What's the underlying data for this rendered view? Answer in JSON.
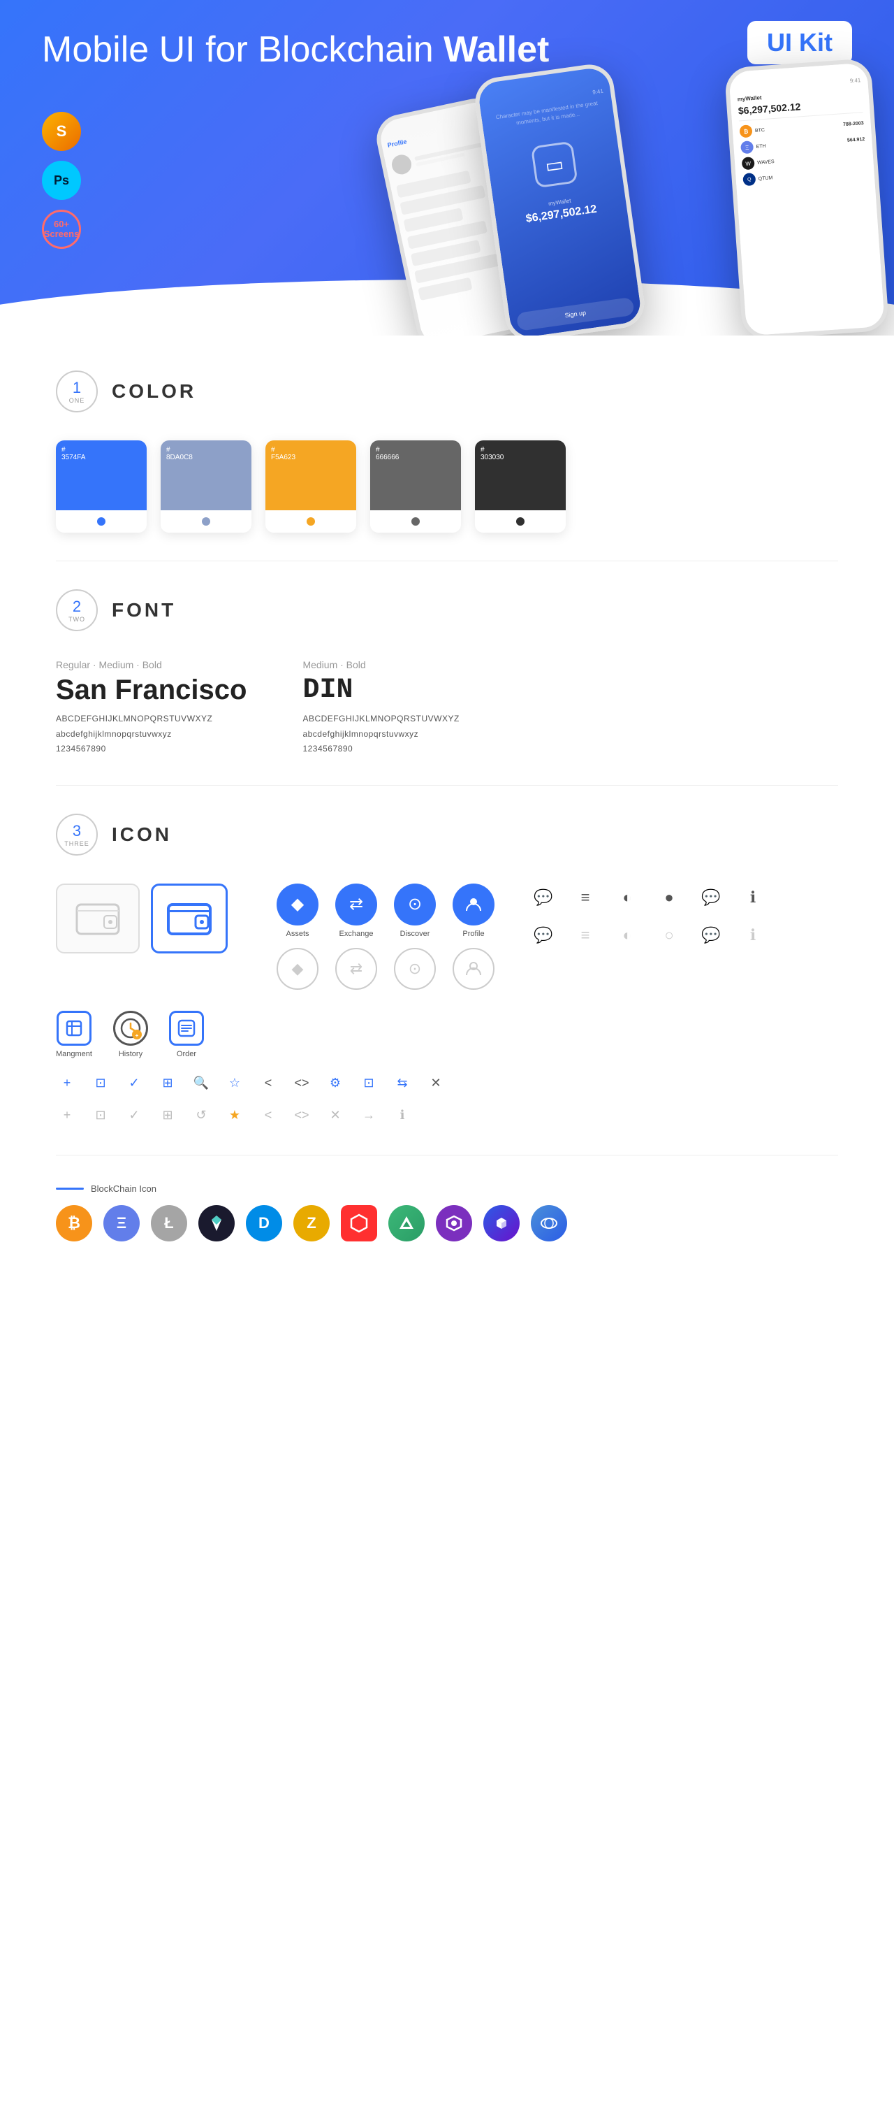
{
  "hero": {
    "title_normal": "Mobile UI for Blockchain ",
    "title_bold": "Wallet",
    "ui_kit_label": "UI Kit",
    "badges": [
      {
        "id": "sketch",
        "label": "S",
        "type": "sketch"
      },
      {
        "id": "photoshop",
        "label": "Ps",
        "type": "ps"
      },
      {
        "id": "screens",
        "label": "60+\nScreens",
        "type": "screens"
      }
    ]
  },
  "sections": {
    "color": {
      "number": "1",
      "word": "ONE",
      "title": "COLOR",
      "swatches": [
        {
          "id": "blue",
          "hex": "#3574FA",
          "label": "#\n3574FA",
          "dot": "#4A88FF"
        },
        {
          "id": "gray",
          "hex": "#8DA0C8",
          "label": "#\n8DA0C8",
          "dot": "#9EB1D9"
        },
        {
          "id": "orange",
          "hex": "#F5A623",
          "label": "#\nF5A623",
          "dot": "#FFC040"
        },
        {
          "id": "darkgray",
          "hex": "#666666",
          "label": "#\n666666",
          "dot": "#888"
        },
        {
          "id": "black",
          "hex": "#303030",
          "label": "#\n303030",
          "dot": "#555"
        }
      ]
    },
    "font": {
      "number": "2",
      "word": "TWO",
      "title": "FONT",
      "fonts": [
        {
          "id": "sf",
          "label": "Regular · Medium · Bold",
          "name": "San Francisco",
          "uppercase": "ABCDEFGHIJKLMNOPQRSTUVWXYZ",
          "lowercase": "abcdefghijklmnopqrstuvwxyz",
          "digits": "1234567890"
        },
        {
          "id": "din",
          "label": "Medium · Bold",
          "name": "DIN",
          "uppercase": "ABCDEFGHIJKLMNOPQRSTUVWXYZ",
          "lowercase": "abcdefghijklmnopqrstuvwxyz",
          "digits": "1234567890"
        }
      ]
    },
    "icon": {
      "number": "3",
      "word": "THREE",
      "title": "ICON",
      "nav_icons": [
        {
          "id": "assets",
          "label": "Assets",
          "symbol": "◆"
        },
        {
          "id": "exchange",
          "label": "Exchange",
          "symbol": "⇄"
        },
        {
          "id": "discover",
          "label": "Discover",
          "symbol": "⊙"
        },
        {
          "id": "profile",
          "label": "Profile",
          "symbol": "👤"
        }
      ],
      "app_icons": [
        {
          "id": "management",
          "label": "Mangment",
          "type": "rect-blue"
        },
        {
          "id": "history",
          "label": "History",
          "type": "clock"
        },
        {
          "id": "order",
          "label": "Order",
          "type": "list-blue"
        }
      ],
      "misc_icons_row1": [
        "💬",
        "≡≡",
        "◐",
        "●",
        "💬",
        "ℹ"
      ],
      "small_icons_blue": [
        "+",
        "⊡",
        "✓",
        "⊞",
        "🔍",
        "☆",
        "<",
        "<>",
        "⚙",
        "⊡",
        "⇆",
        "✕"
      ],
      "small_icons_gray": [
        "+",
        "⊡",
        "✓",
        "⊞",
        "↺",
        "★",
        "<",
        "<>",
        "✕",
        "→",
        "ℹ"
      ],
      "blockchain_label": "BlockChain Icon",
      "blockchain_coins": [
        {
          "id": "bitcoin",
          "symbol": "₿",
          "bg": "#F7931A"
        },
        {
          "id": "ethereum",
          "symbol": "Ξ",
          "bg": "#627EEA"
        },
        {
          "id": "litecoin",
          "symbol": "Ł",
          "bg": "#A5A5A5"
        },
        {
          "id": "feather",
          "symbol": "◈",
          "bg": "#1A1A2E"
        },
        {
          "id": "dash",
          "symbol": "D",
          "bg": "#008CE7"
        },
        {
          "id": "zcash",
          "symbol": "Z",
          "bg": "#E8AA00"
        },
        {
          "id": "hex",
          "symbol": "⬡",
          "bg": "#FF3030"
        },
        {
          "id": "augur",
          "symbol": "▲",
          "bg": "#3CB878"
        },
        {
          "id": "civic",
          "symbol": "◇",
          "bg": "#7B2FBE"
        },
        {
          "id": "matic",
          "symbol": "⬡",
          "bg": "#2B5CE6"
        }
      ]
    }
  }
}
